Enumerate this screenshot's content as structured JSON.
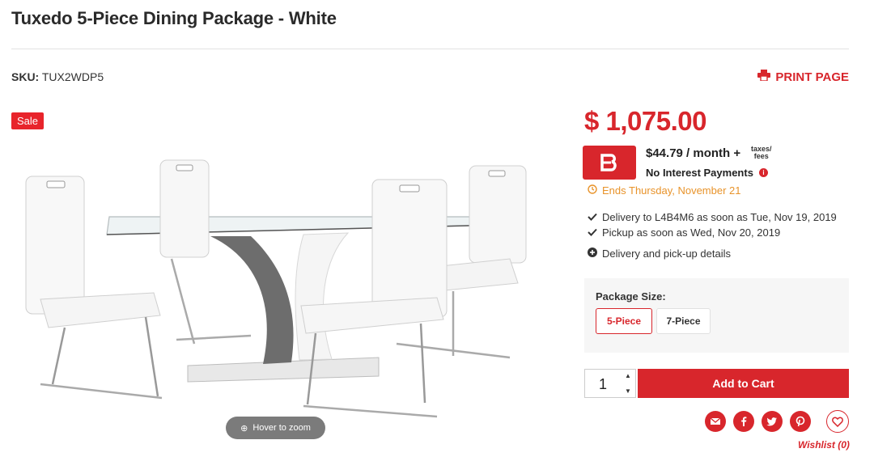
{
  "page": {
    "title": "Tuxedo 5-Piece Dining Package - White",
    "sku_label": "SKU:",
    "sku_value": "TUX2WDP5",
    "print_label": "PRINT PAGE"
  },
  "product_image": {
    "badge": "Sale",
    "zoom_hint": "Hover to zoom"
  },
  "pricing": {
    "price": "$ 1,075.00",
    "financing_logo": "B",
    "monthly": "$44.79 / month +",
    "taxes_line1": "taxes/",
    "taxes_line2": "fees",
    "no_interest": "No Interest Payments",
    "ends": "Ends Thursday, November 21"
  },
  "delivery": {
    "delivery_line": "Delivery to L4B4M6 as soon as Tue, Nov 19, 2019",
    "pickup_line": "Pickup as soon as Wed, Nov 20, 2019",
    "details_link": "Delivery and pick-up details"
  },
  "package": {
    "label": "Package Size:",
    "options": [
      "5-Piece",
      "7-Piece"
    ],
    "selected": "5-Piece"
  },
  "cart": {
    "quantity": "1",
    "add_label": "Add to Cart"
  },
  "share": {
    "icons": [
      "email-icon",
      "facebook-icon",
      "twitter-icon",
      "pinterest-icon"
    ],
    "wishlist_label": "Wishlist (0)"
  },
  "colors": {
    "accent": "#d8262c",
    "orange": "#e8932a"
  }
}
